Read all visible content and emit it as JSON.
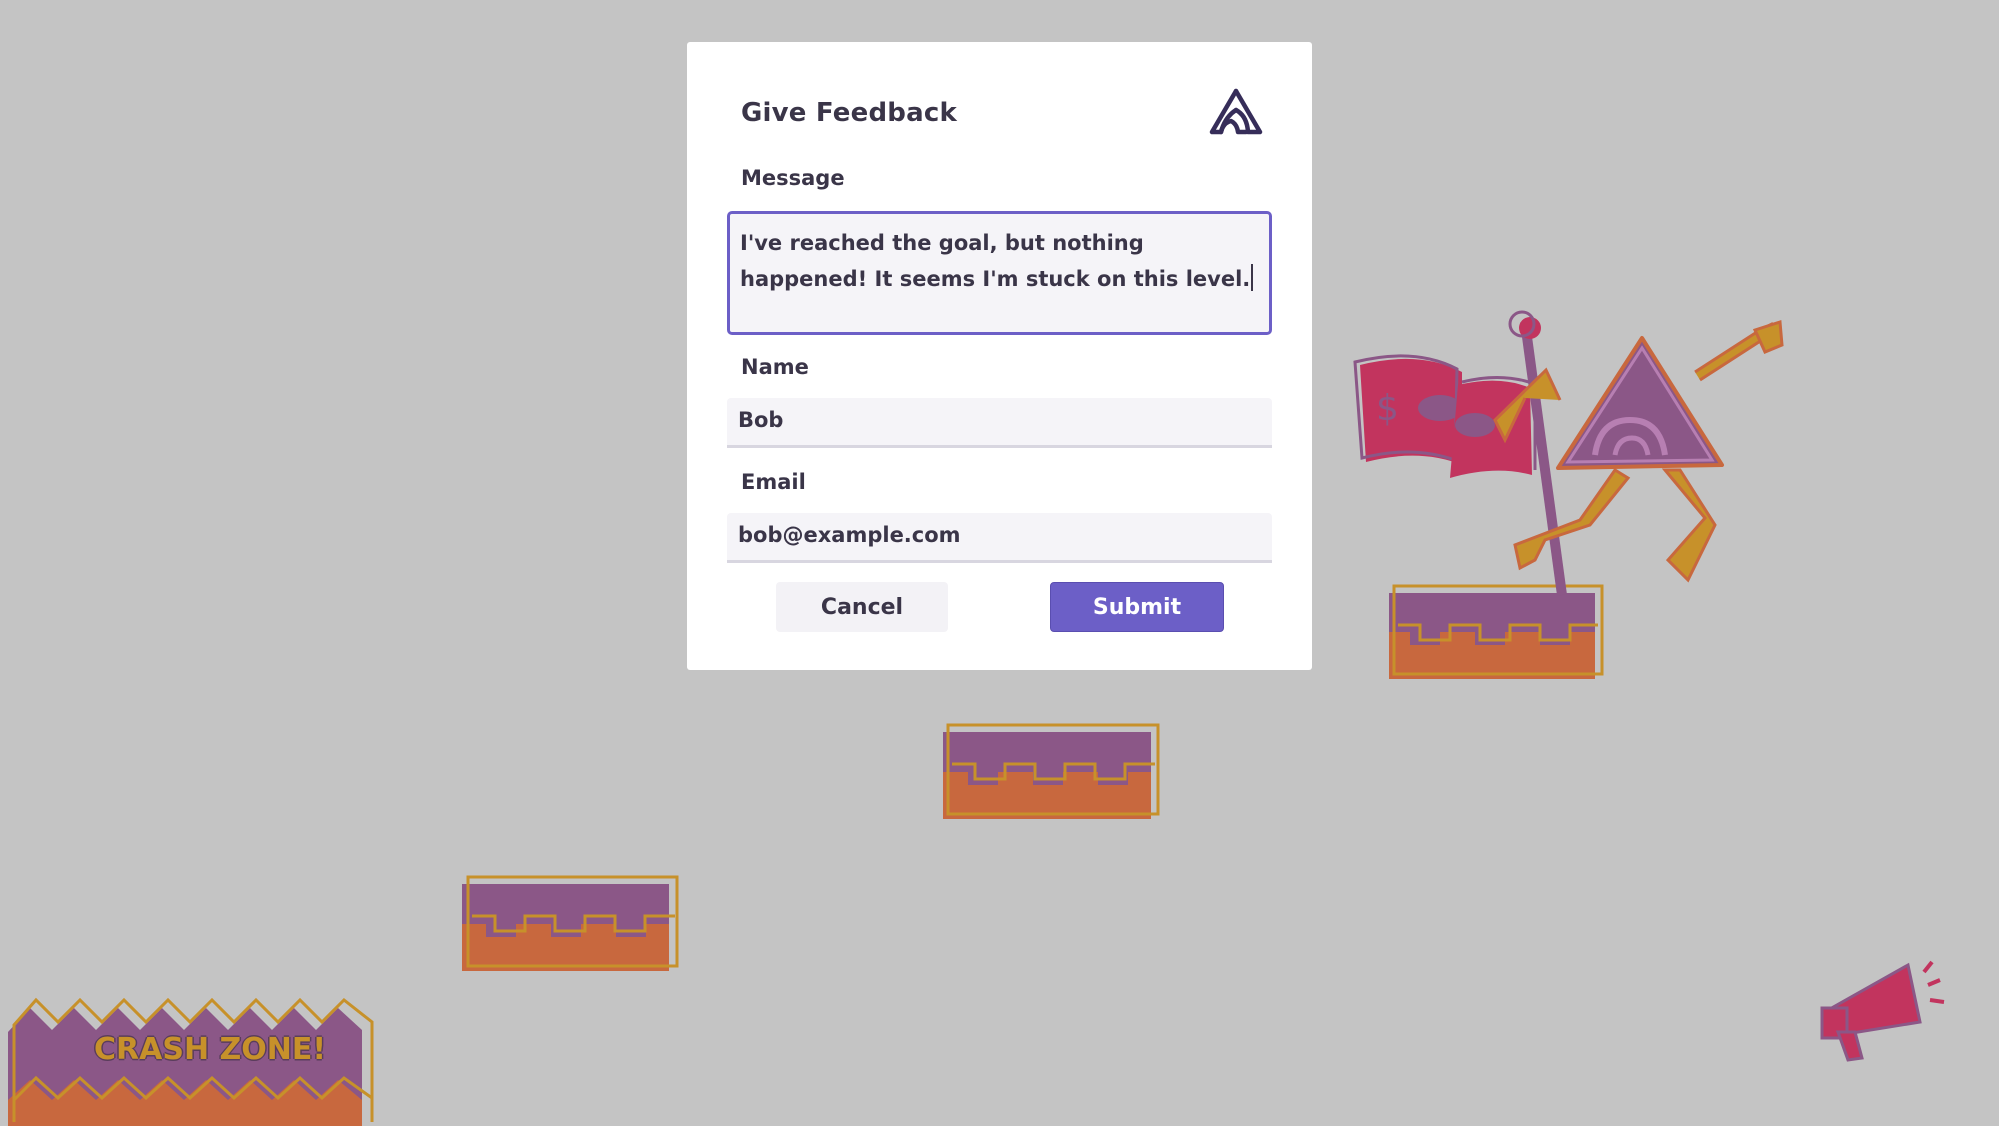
{
  "dialog": {
    "title": "Give Feedback",
    "message_label": "Message",
    "message_value": "I've reached the goal, but nothing happened! It seems I'm stuck on this level.",
    "name_label": "Name",
    "name_value": "Bob",
    "email_label": "Email",
    "email_value": "bob@example.com",
    "cancel_label": "Cancel",
    "submit_label": "Submit"
  },
  "game": {
    "crash_zone_sign": "CRASH ZONE!"
  },
  "colors": {
    "accent": "#6c5fc7",
    "background": "#c4c4c4",
    "platform_purple": "#8b5787",
    "platform_orange": "#c8683e",
    "outline_gold": "#c7912a",
    "flag_red": "#c2345e"
  },
  "icons": [
    "sentry-logo-icon",
    "megaphone-icon",
    "character-mascot"
  ]
}
